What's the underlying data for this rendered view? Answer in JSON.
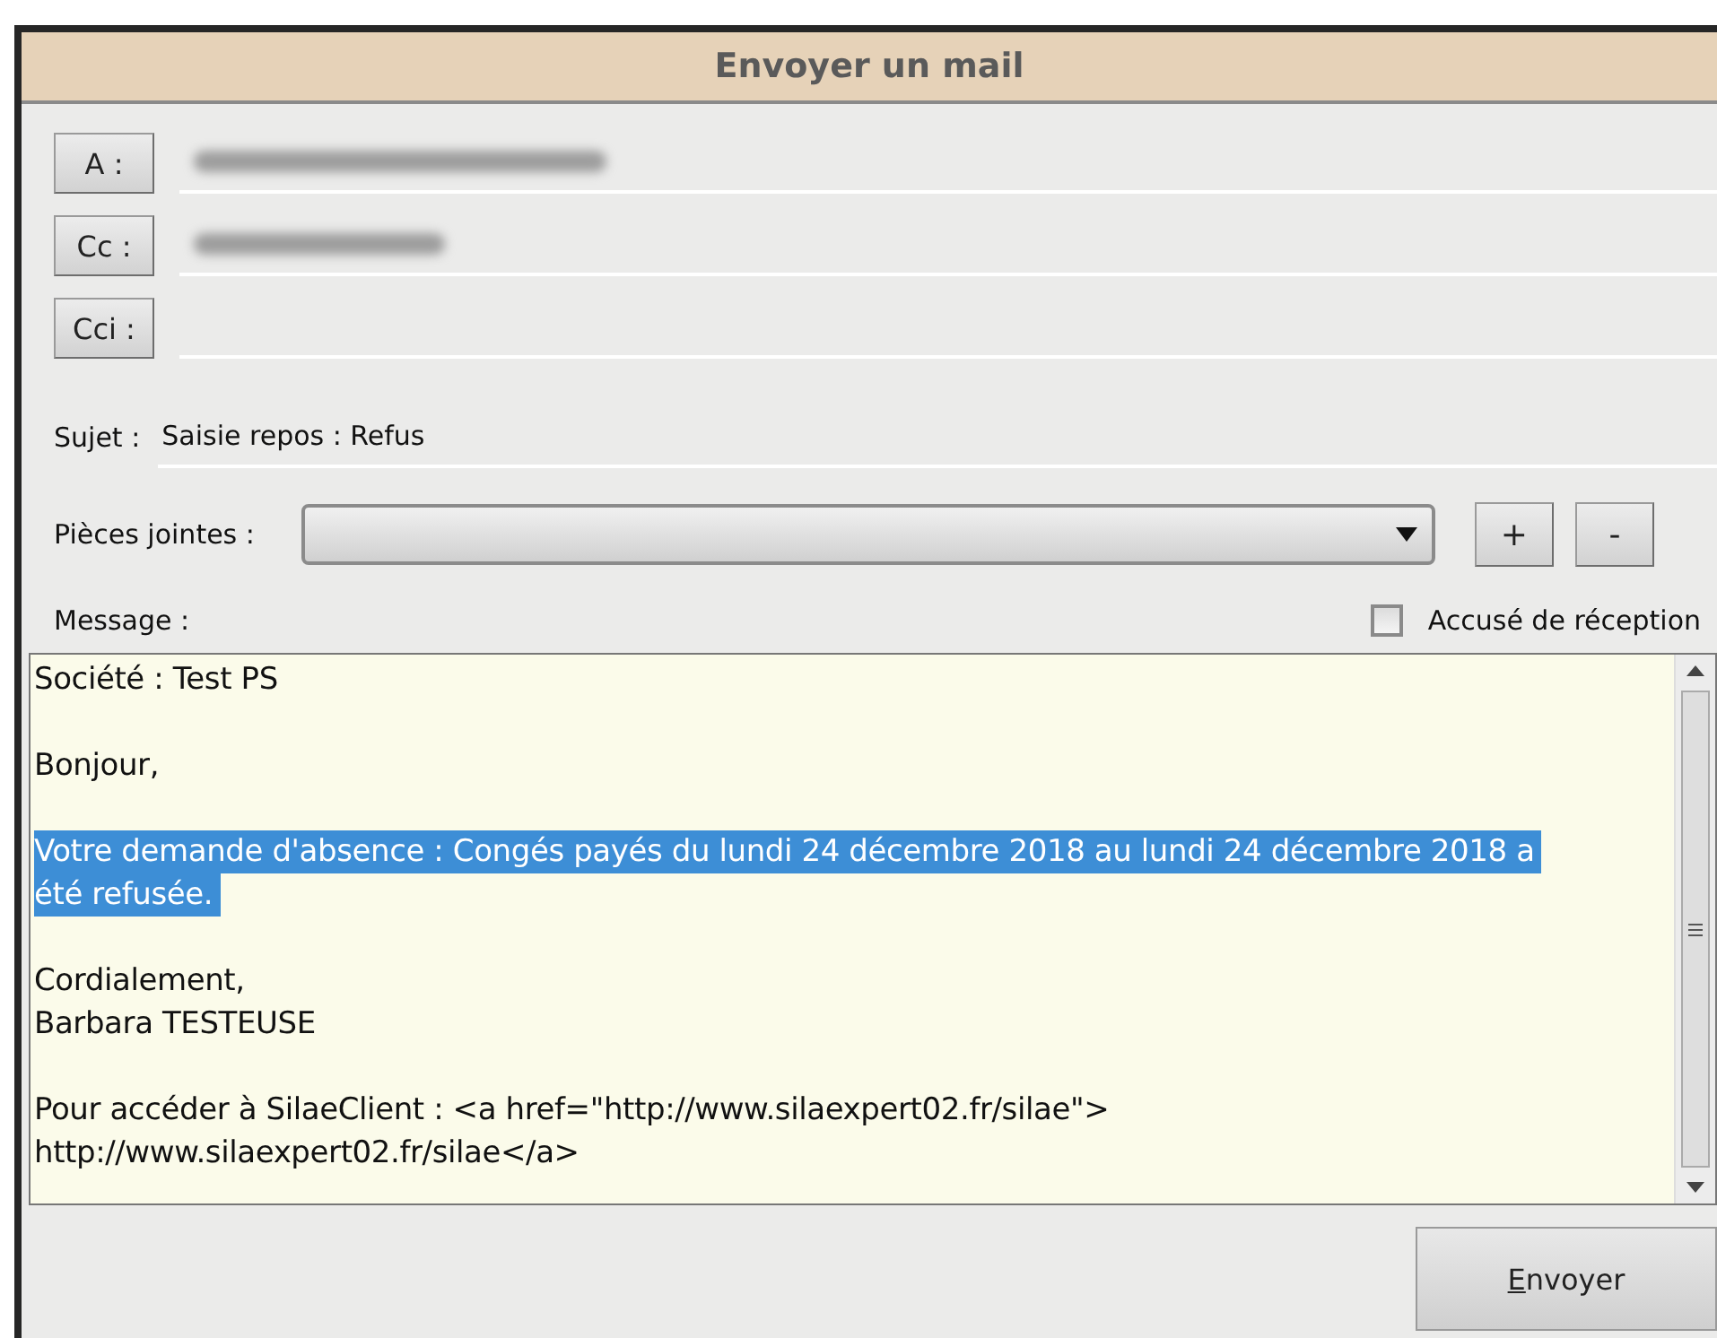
{
  "window": {
    "title": "Envoyer un mail"
  },
  "recipients": [
    {
      "button": "A :",
      "redacted": true
    },
    {
      "button": "Cc :",
      "redacted": true
    },
    {
      "button": "Cci :",
      "redacted": false
    }
  ],
  "subject": {
    "label": "Sujet :",
    "value": "Saisie repos : Refus"
  },
  "attachments": {
    "label": "Pièces jointes :",
    "add": "+",
    "remove": "-"
  },
  "message": {
    "label": "Message :",
    "receipt": {
      "label": "Accusé de réception",
      "checked": false
    },
    "lines": [
      {
        "text": "Société : Test PS",
        "selected": false
      },
      {
        "text": "Bonjour,",
        "selected": false,
        "gap_before": true
      },
      {
        "text": "Votre demande d'absence : Congés payés du lundi 24 décembre 2018 au lundi 24 décembre 2018 a",
        "selected": true,
        "gap_before": true
      },
      {
        "text": "été refusée.",
        "selected": true
      },
      {
        "text": "Cordialement,",
        "selected": false,
        "gap_before": true
      },
      {
        "text": "Barbara TESTEUSE",
        "selected": false
      },
      {
        "text": "Pour accéder à SilaeClient : <a href=\"http://www.silaexpert02.fr/silae\">",
        "selected": false,
        "gap_before": true
      },
      {
        "text": "http://www.silaexpert02.fr/silae</a>",
        "selected": false
      }
    ]
  },
  "send": "Envoyer"
}
